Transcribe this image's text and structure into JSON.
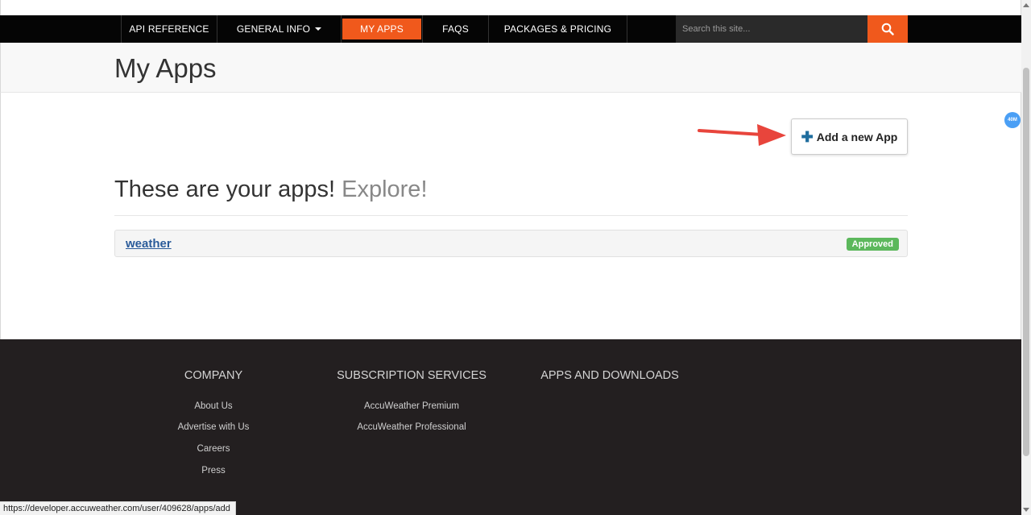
{
  "nav": {
    "items": [
      {
        "label": "API REFERENCE"
      },
      {
        "label": "GENERAL INFO"
      },
      {
        "label": "MY APPS"
      },
      {
        "label": "FAQS"
      },
      {
        "label": "PACKAGES & PRICING"
      }
    ],
    "search_placeholder": "Search this site...",
    "search_icon": "search-icon"
  },
  "page": {
    "title": "My Apps",
    "add_button_label": "Add a new App",
    "heading": "These are your apps!",
    "heading_explore": "Explore!"
  },
  "apps": [
    {
      "name": "weather",
      "status": "Approved"
    }
  ],
  "floating_badge": "40M",
  "footer": {
    "company": {
      "title": "COMPANY",
      "links": [
        "About Us",
        "Advertise with Us",
        "Careers",
        "Press"
      ]
    },
    "subscription": {
      "title": "SUBSCRIPTION SERVICES",
      "links": [
        "AccuWeather Premium",
        "AccuWeather Professional"
      ]
    },
    "apps": {
      "title": "APPS AND DOWNLOADS"
    }
  },
  "status_bar_url": "https://developer.accuweather.com/user/409628/apps/add",
  "colors": {
    "accent": "#f0591c",
    "nav_bg": "#050505",
    "footer_bg": "#231f20",
    "approved": "#5cb85c",
    "link": "#2a5b9a"
  }
}
